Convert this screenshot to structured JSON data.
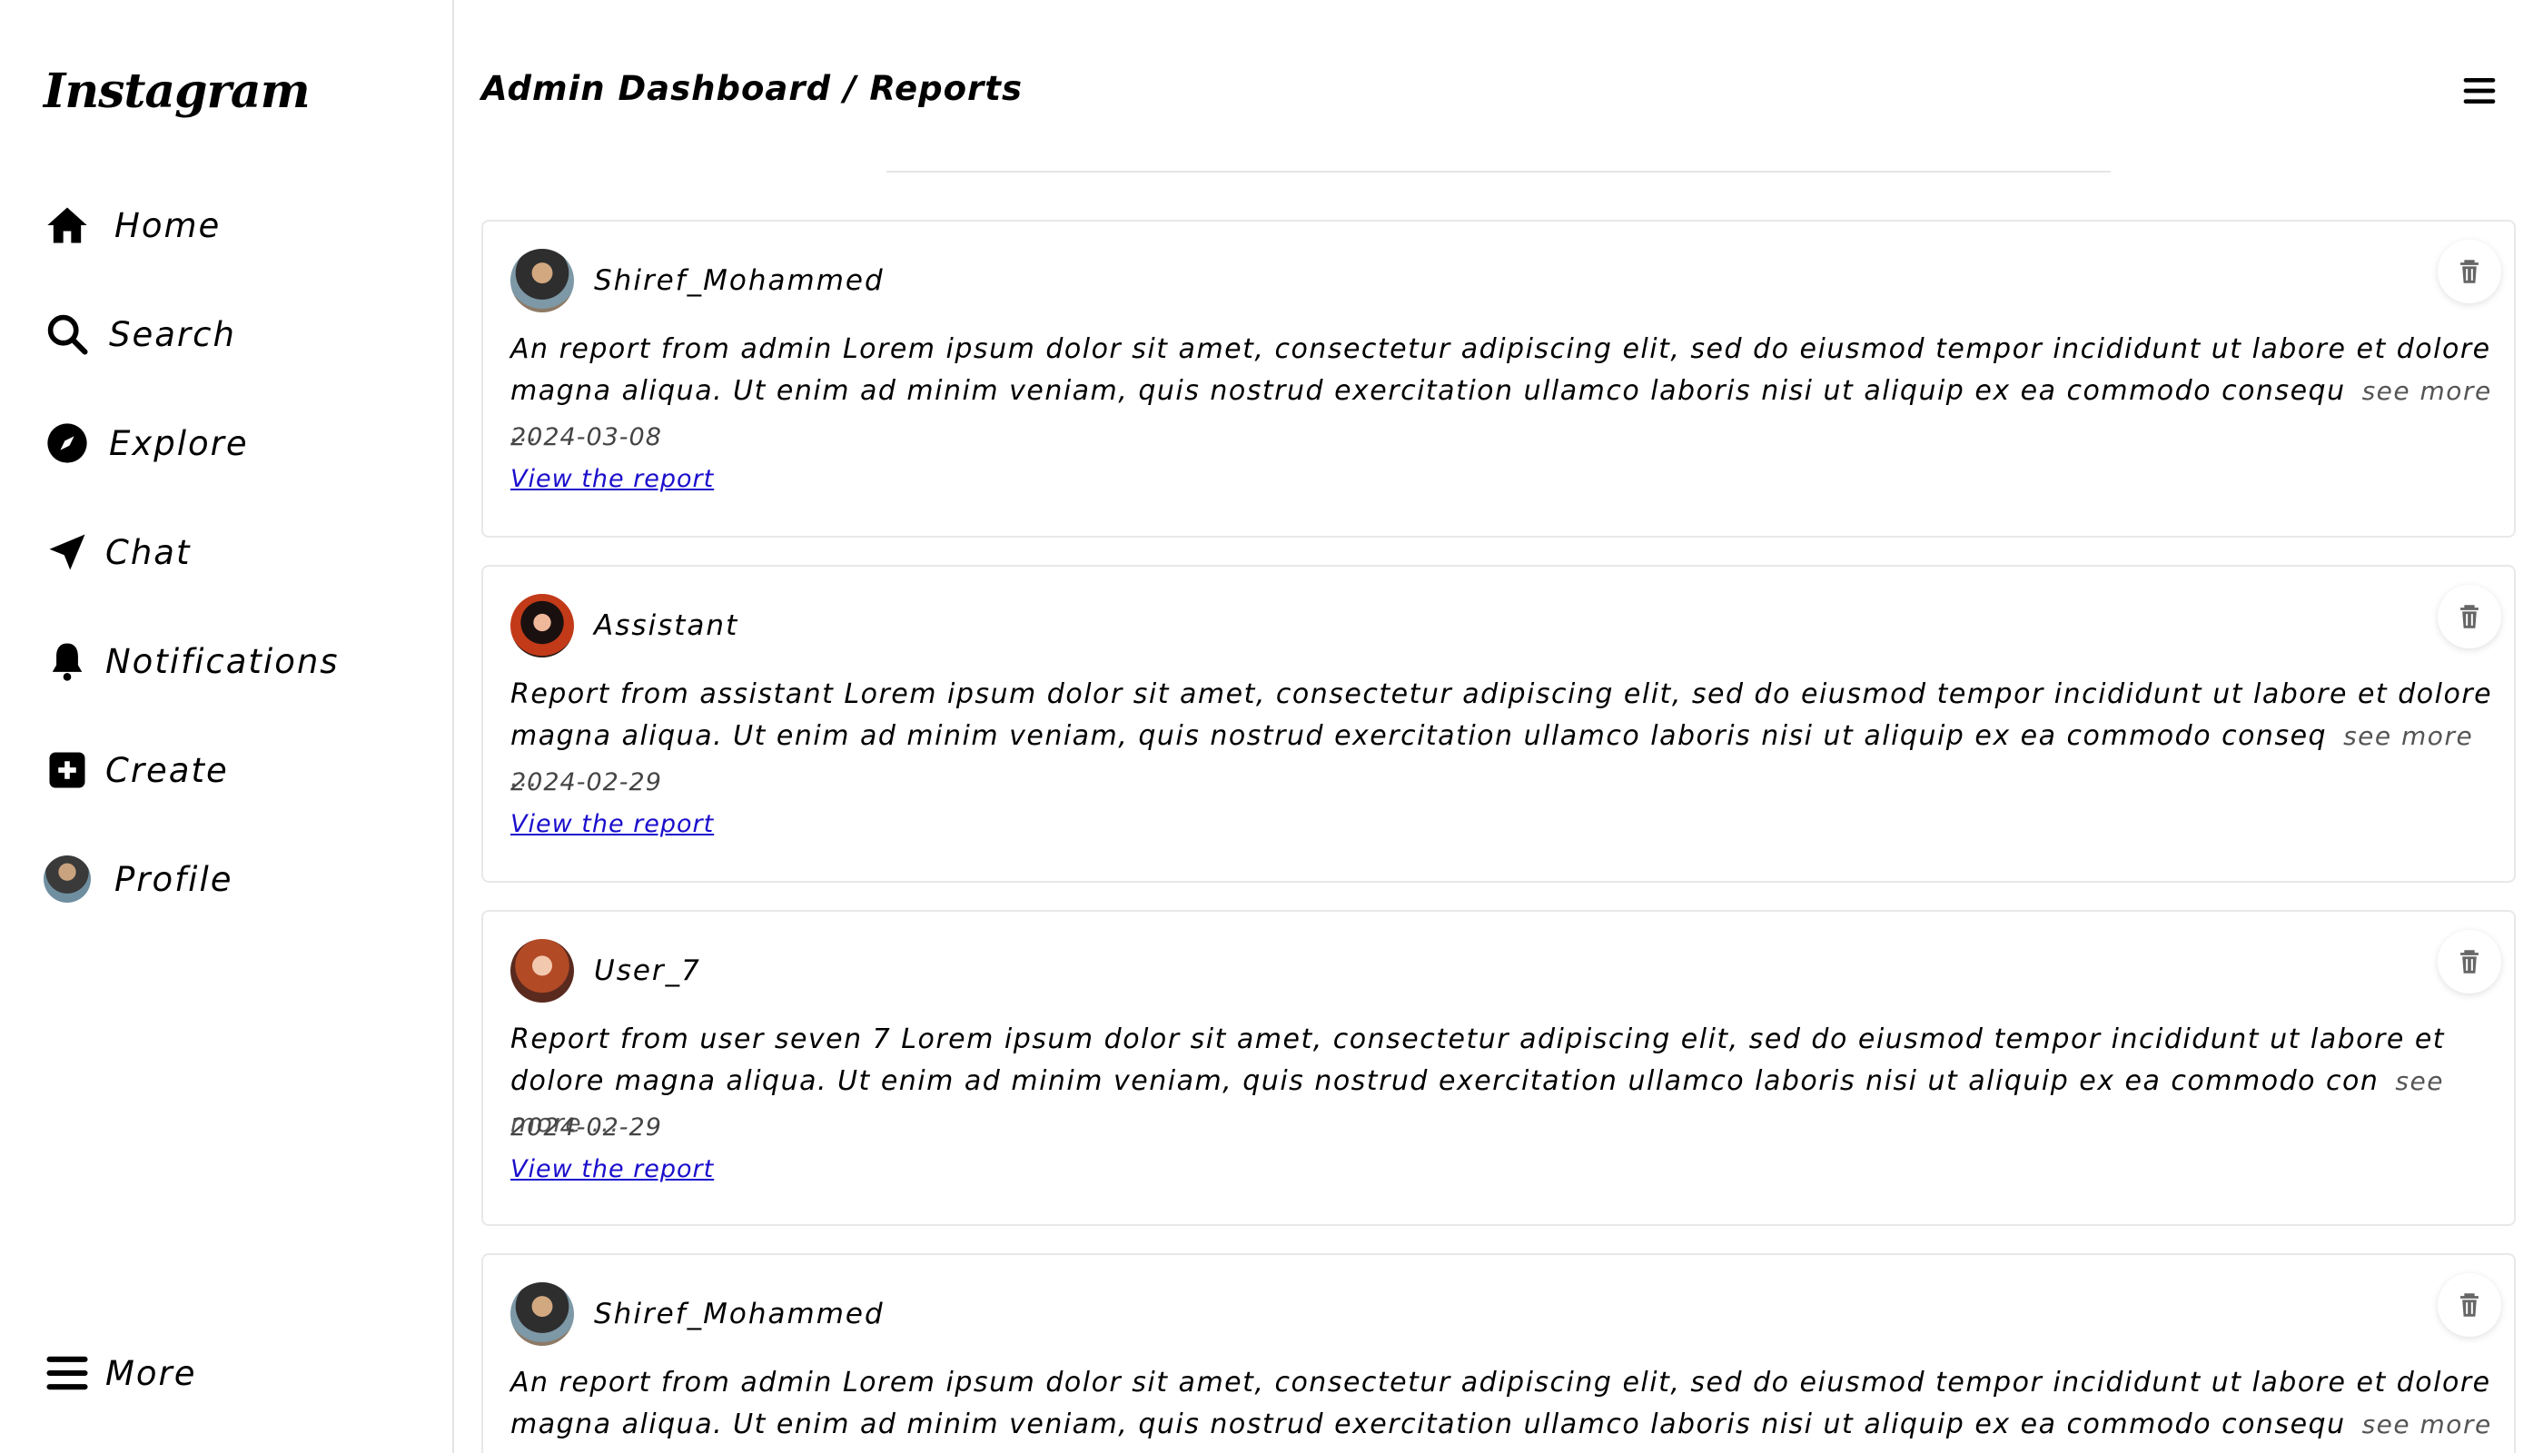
{
  "sidebar": {
    "logo": "Instagram",
    "items": [
      {
        "label": "Home"
      },
      {
        "label": "Search"
      },
      {
        "label": "Explore"
      },
      {
        "label": "Chat"
      },
      {
        "label": "Notifications"
      },
      {
        "label": "Create"
      },
      {
        "label": "Profile"
      }
    ],
    "more": "More"
  },
  "header": {
    "title": "Admin Dashboard / Reports"
  },
  "reports": [
    {
      "username": "Shiref_Mohammed",
      "text": "An report from admin Lorem ipsum dolor sit amet, consectetur adipiscing elit, sed do eiusmod tempor incididunt ut labore et dolore magna aliqua. Ut enim ad minim veniam, quis nostrud exercitation ullamco laboris nisi ut aliquip ex ea commodo consequ",
      "see_more": "see more ...",
      "date": "2024-03-08",
      "link": "View the report"
    },
    {
      "username": "Assistant",
      "text": "Report from assistant Lorem ipsum dolor sit amet, consectetur adipiscing elit, sed do eiusmod tempor incididunt ut labore et dolore magna aliqua. Ut enim ad minim veniam, quis nostrud exercitation ullamco laboris nisi ut aliquip ex ea commodo conseq",
      "see_more": "see more ...",
      "date": "2024-02-29",
      "link": "View the report"
    },
    {
      "username": "User_7",
      "text": "Report from user seven 7 Lorem ipsum dolor sit amet, consectetur adipiscing elit, sed do eiusmod tempor incididunt ut labore et dolore magna aliqua. Ut enim ad minim veniam, quis nostrud exercitation ullamco laboris nisi ut aliquip ex ea commodo con",
      "see_more": "see more ...",
      "date": "2024-02-29",
      "link": "View the report"
    },
    {
      "username": "Shiref_Mohammed",
      "text": "An report from admin Lorem ipsum dolor sit amet, consectetur adipiscing elit, sed do eiusmod tempor incididunt ut labore et dolore magna aliqua. Ut enim ad minim veniam, quis nostrud exercitation ullamco laboris nisi ut aliquip ex ea commodo consequ",
      "see_more": "see more ..."
    }
  ]
}
